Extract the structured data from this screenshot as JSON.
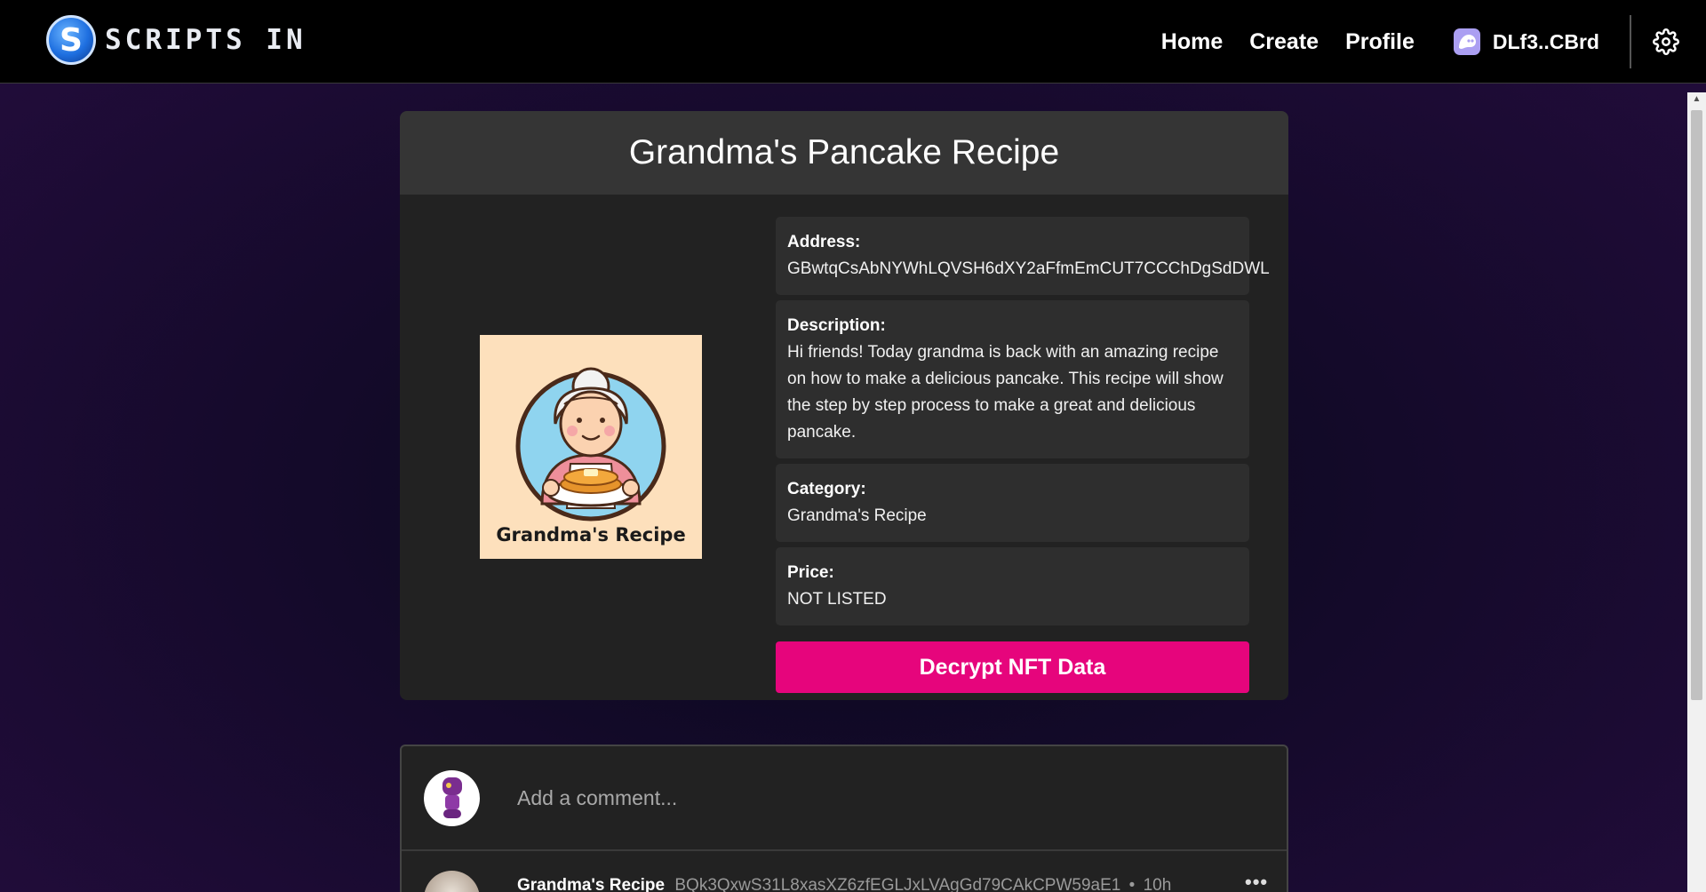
{
  "header": {
    "logo_text": "SCRIPTS IN",
    "nav": [
      "Home",
      "Create",
      "Profile"
    ],
    "wallet_label": "DLf3..CBrd"
  },
  "nft": {
    "title": "Grandma's Pancake Recipe",
    "image_caption": "Grandma's Recipe",
    "address_label": "Address:",
    "address": "GBwtqCsAbNYWhLQVSH6dXY2aFfmEmCUT7CCChDgSdDWL",
    "description_label": "Description:",
    "description": "Hi friends! Today grandma is back with an amazing recipe on how to make a delicious pancake. This recipe will show the step by step process to make a great and delicious pancake.",
    "category_label": "Category:",
    "category": "Grandma's Recipe",
    "price_label": "Price:",
    "price": "NOT LISTED",
    "decrypt_button": "Decrypt NFT Data"
  },
  "comments": {
    "placeholder": "Add a comment...",
    "items": [
      {
        "author": "Grandma's Recipe",
        "address": "BQk3QxwS31L8xasXZ6zfEGLJxLVAgGd79CAkCPW59aE1",
        "separator": "•",
        "time": "10h"
      }
    ]
  },
  "colors": {
    "accent": "#e6057c",
    "header_bg": "#000000",
    "card_bg": "#222222"
  }
}
